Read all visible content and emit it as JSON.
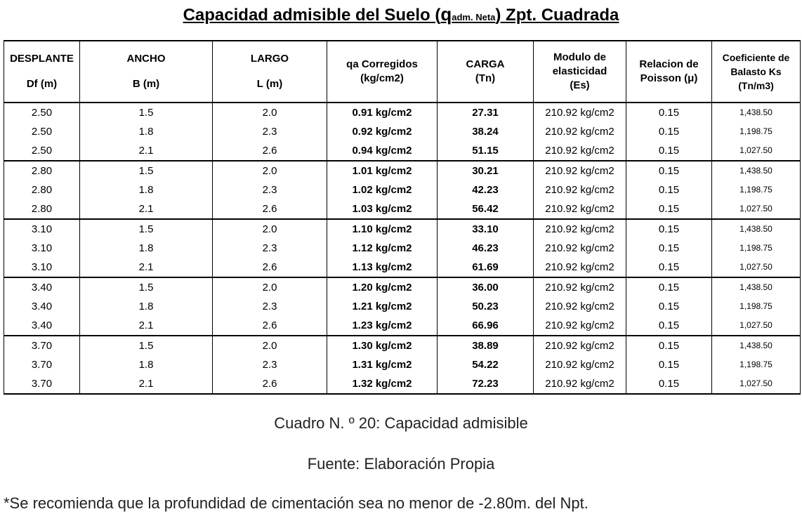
{
  "title": {
    "main": "Capacidad admisible del Suelo (",
    "q": "q",
    "sub": "adm. Neta",
    "end": ") Zpt. Cuadrada"
  },
  "headers": [
    {
      "top": "DESPLANTE",
      "bottom": "Df (m)"
    },
    {
      "top": "ANCHO",
      "bottom": "B (m)"
    },
    {
      "top": "LARGO",
      "bottom": "L (m)"
    },
    {
      "top": "qa Corregidos",
      "bottom": "(kg/cm2)"
    },
    {
      "top": "CARGA",
      "bottom": "(Tn)"
    },
    {
      "top": "Modulo de",
      "middle": "elasticidad",
      "bottom": "(Es)"
    },
    {
      "top": "Relacion de",
      "bottom": "Poisson (μ)"
    },
    {
      "top": "Coeficiente de",
      "middle": "Balasto Ks",
      "bottom": "(Tn/m3)"
    }
  ],
  "rows": [
    [
      "2.50",
      "1.5",
      "2.0",
      "0.91 kg/cm2",
      "27.31",
      "210.92 kg/cm2",
      "0.15",
      "1,438.50"
    ],
    [
      "2.50",
      "1.8",
      "2.3",
      "0.92 kg/cm2",
      "38.24",
      "210.92 kg/cm2",
      "0.15",
      "1,198.75"
    ],
    [
      "2.50",
      "2.1",
      "2.6",
      "0.94 kg/cm2",
      "51.15",
      "210.92 kg/cm2",
      "0.15",
      "1,027.50"
    ],
    [
      "2.80",
      "1.5",
      "2.0",
      "1.01 kg/cm2",
      "30.21",
      "210.92 kg/cm2",
      "0.15",
      "1,438.50"
    ],
    [
      "2.80",
      "1.8",
      "2.3",
      "1.02 kg/cm2",
      "42.23",
      "210.92 kg/cm2",
      "0.15",
      "1,198.75"
    ],
    [
      "2.80",
      "2.1",
      "2.6",
      "1.03 kg/cm2",
      "56.42",
      "210.92 kg/cm2",
      "0.15",
      "1,027.50"
    ],
    [
      "3.10",
      "1.5",
      "2.0",
      "1.10 kg/cm2",
      "33.10",
      "210.92 kg/cm2",
      "0.15",
      "1,438.50"
    ],
    [
      "3.10",
      "1.8",
      "2.3",
      "1.12 kg/cm2",
      "46.23",
      "210.92 kg/cm2",
      "0.15",
      "1,198.75"
    ],
    [
      "3.10",
      "2.1",
      "2.6",
      "1.13 kg/cm2",
      "61.69",
      "210.92 kg/cm2",
      "0.15",
      "1,027.50"
    ],
    [
      "3.40",
      "1.5",
      "2.0",
      "1.20 kg/cm2",
      "36.00",
      "210.92 kg/cm2",
      "0.15",
      "1,438.50"
    ],
    [
      "3.40",
      "1.8",
      "2.3",
      "1.21 kg/cm2",
      "50.23",
      "210.92 kg/cm2",
      "0.15",
      "1,198.75"
    ],
    [
      "3.40",
      "2.1",
      "2.6",
      "1.23 kg/cm2",
      "66.96",
      "210.92 kg/cm2",
      "0.15",
      "1,027.50"
    ],
    [
      "3.70",
      "1.5",
      "2.0",
      "1.30 kg/cm2",
      "38.89",
      "210.92 kg/cm2",
      "0.15",
      "1,438.50"
    ],
    [
      "3.70",
      "1.8",
      "2.3",
      "1.31 kg/cm2",
      "54.22",
      "210.92 kg/cm2",
      "0.15",
      "1,198.75"
    ],
    [
      "3.70",
      "2.1",
      "2.6",
      "1.32 kg/cm2",
      "72.23",
      "210.92 kg/cm2",
      "0.15",
      "1,027.50"
    ]
  ],
  "caption": "Cuadro N. º 20: Capacidad admisible",
  "source": "Fuente: Elaboración Propia",
  "note": "*Se recomienda que la profundidad de cimentación sea no menor de -2.80m. del Npt."
}
